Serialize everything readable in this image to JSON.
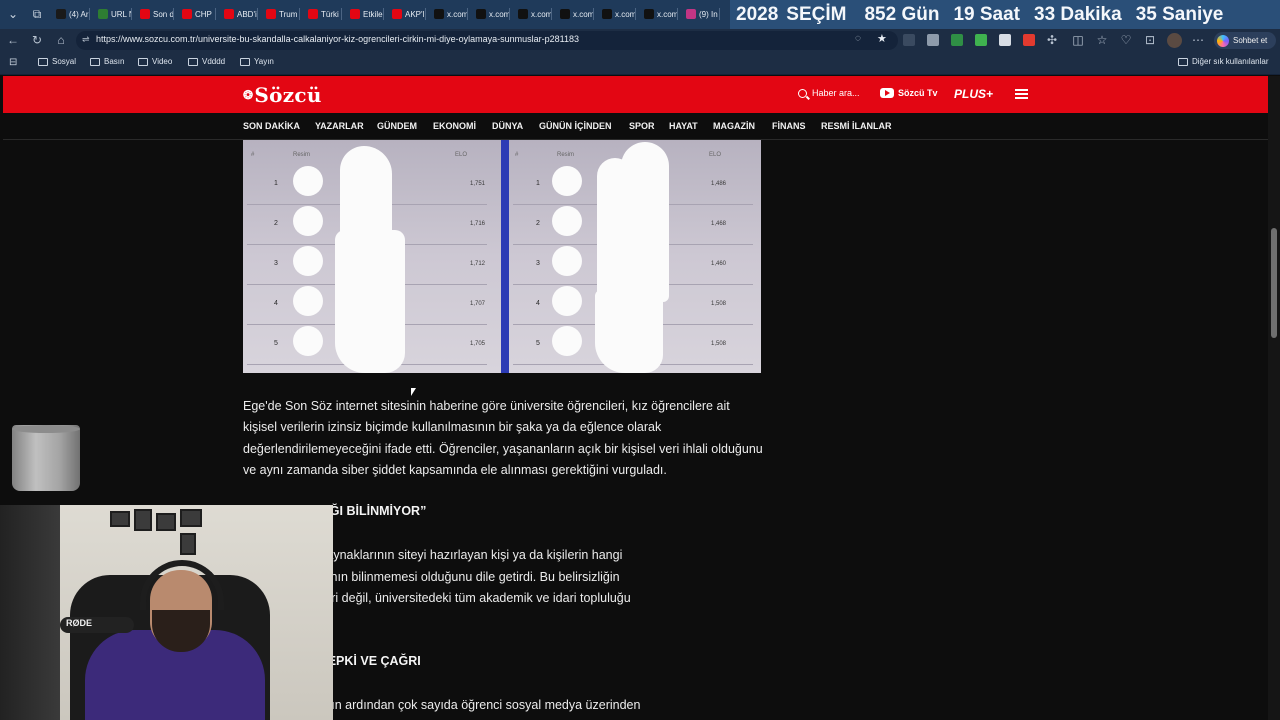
{
  "browser": {
    "tabs": [
      {
        "label": "(4) Ar",
        "color": "#1a1a1a"
      },
      {
        "label": "URL N",
        "color": "#2e7d32"
      },
      {
        "label": "Son d",
        "color": "#e30613"
      },
      {
        "label": "CHP",
        "color": "#e30613"
      },
      {
        "label": "ABD'i",
        "color": "#e30613"
      },
      {
        "label": "Trum",
        "color": "#e30613"
      },
      {
        "label": "Türki",
        "color": "#e30613"
      },
      {
        "label": "Etkile",
        "color": "#e30613"
      },
      {
        "label": "AKP'l",
        "color": "#e30613"
      },
      {
        "label": "x.com",
        "color": "#111111"
      },
      {
        "label": "x.com",
        "color": "#111111"
      },
      {
        "label": "x.com",
        "color": "#111111"
      },
      {
        "label": "x.com",
        "color": "#111111"
      },
      {
        "label": "x.com",
        "color": "#111111"
      },
      {
        "label": "x.com",
        "color": "#111111"
      },
      {
        "label": "(9) In",
        "color": "#c13584"
      }
    ],
    "countdown": {
      "year": "2028",
      "event": "SEÇİM",
      "days": "852 Gün",
      "hours": "19 Saat",
      "minutes": "33 Dakika",
      "seconds": "35 Saniye"
    },
    "url": "https://www.sozcu.com.tr/universite-bu-skandalla-calkalaniyor-kiz-ogrencileri-cirkin-mi-diye-oylamaya-sunmuslar-p281183",
    "chat_label": "Sohbet et",
    "bookmarks": [
      "Sosyal",
      "Basın",
      "Video",
      "Vdddd",
      "Yayın"
    ],
    "other_bookmarks": "Diğer sık kullanılanlar"
  },
  "site": {
    "logo": "Sözcü",
    "search_placeholder": "Haber ara...",
    "tv_label": "Sözcü Tv",
    "plus_label": "PLUS+",
    "nav": [
      "SON DAKİKA",
      "YAZARLAR",
      "GÜNDEM",
      "EKONOMİ",
      "DÜNYA",
      "GÜNÜN İÇİNDEN",
      "SPOR",
      "HAYAT",
      "MAGAZİN",
      "FİNANS",
      "RESMİ İLANLAR"
    ]
  },
  "figure": {
    "left_panel": {
      "head_rank": "#",
      "head_face": "Resim",
      "head_elo": "ELO",
      "rows": [
        {
          "rank": "1",
          "elo": "1,751"
        },
        {
          "rank": "2",
          "elo": "1,716"
        },
        {
          "rank": "3",
          "elo": "1,712"
        },
        {
          "rank": "4",
          "elo": "1,707"
        },
        {
          "rank": "5",
          "elo": "1,705"
        }
      ]
    },
    "right_panel": {
      "head_rank": "#",
      "head_face": "Resim",
      "head_elo": "ELO",
      "rows": [
        {
          "rank": "1",
          "elo": "1,486"
        },
        {
          "rank": "2",
          "elo": "1,468"
        },
        {
          "rank": "3",
          "elo": "1,460"
        },
        {
          "rank": "4",
          "elo": "1,508"
        },
        {
          "rank": "5",
          "elo": "1,508"
        }
      ]
    }
  },
  "article": {
    "para1": "Ege'de Son Söz internet sitesinin haberine göre üniversite öğrencileri, kız öğrencilere ait kişisel verilerin izinsiz biçimde kullanılmasının bir şaka ya da eğlence olarak değerlendirilemeyeceğini ifade etti. Öğrenciler, yaşananların açık bir kişisel veri ihlali olduğunu ve aynı zamanda siber şiddet kapsamında ele alınması gerektiğini vurguladı.",
    "heading1": "ERE ULAŞILDIĞI BİLİNMİYOR”",
    "para2_lines": [
      "büyük endişe kaynaklarının siteyi hazırlayan kişi ya da kişilerin hangi",
      "erişim sağladığının bilinmemesi olduğunu dile getirdi. Bu belirsizliğin",
      "alınan öğrencileri değil, üniversitedeki tüm akademik ve idari topluluğu",
      "elirtildi."
    ],
    "heading2": "ADA ORTAK TEPKİ VE ÇAĞRI",
    "para3": "una yansımasının ardından çok sayıda öğrenci sosyal medya üzerinden"
  },
  "webcam": {
    "mic_label": "RØDE"
  }
}
